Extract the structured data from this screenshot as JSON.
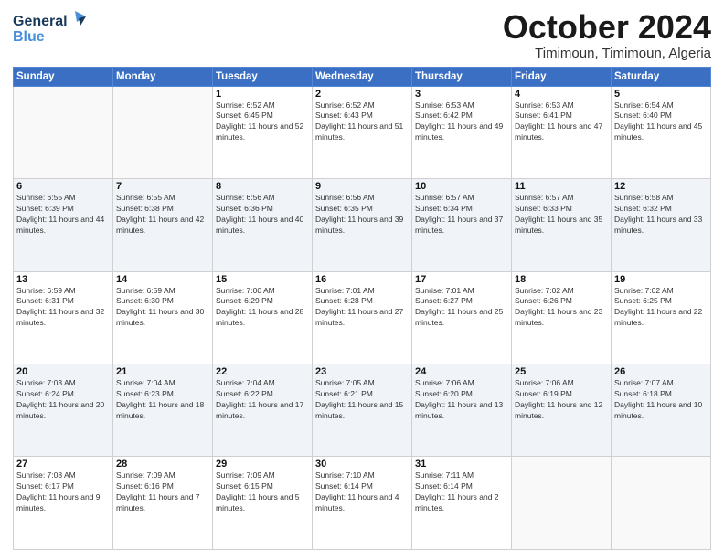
{
  "header": {
    "logo_general": "General",
    "logo_blue": "Blue",
    "month_title": "October 2024",
    "location": "Timimoun, Timimoun, Algeria"
  },
  "weekdays": [
    "Sunday",
    "Monday",
    "Tuesday",
    "Wednesday",
    "Thursday",
    "Friday",
    "Saturday"
  ],
  "weeks": [
    [
      {
        "day": "",
        "sunrise": "",
        "sunset": "",
        "daylight": ""
      },
      {
        "day": "",
        "sunrise": "",
        "sunset": "",
        "daylight": ""
      },
      {
        "day": "1",
        "sunrise": "Sunrise: 6:52 AM",
        "sunset": "Sunset: 6:45 PM",
        "daylight": "Daylight: 11 hours and 52 minutes."
      },
      {
        "day": "2",
        "sunrise": "Sunrise: 6:52 AM",
        "sunset": "Sunset: 6:43 PM",
        "daylight": "Daylight: 11 hours and 51 minutes."
      },
      {
        "day": "3",
        "sunrise": "Sunrise: 6:53 AM",
        "sunset": "Sunset: 6:42 PM",
        "daylight": "Daylight: 11 hours and 49 minutes."
      },
      {
        "day": "4",
        "sunrise": "Sunrise: 6:53 AM",
        "sunset": "Sunset: 6:41 PM",
        "daylight": "Daylight: 11 hours and 47 minutes."
      },
      {
        "day": "5",
        "sunrise": "Sunrise: 6:54 AM",
        "sunset": "Sunset: 6:40 PM",
        "daylight": "Daylight: 11 hours and 45 minutes."
      }
    ],
    [
      {
        "day": "6",
        "sunrise": "Sunrise: 6:55 AM",
        "sunset": "Sunset: 6:39 PM",
        "daylight": "Daylight: 11 hours and 44 minutes."
      },
      {
        "day": "7",
        "sunrise": "Sunrise: 6:55 AM",
        "sunset": "Sunset: 6:38 PM",
        "daylight": "Daylight: 11 hours and 42 minutes."
      },
      {
        "day": "8",
        "sunrise": "Sunrise: 6:56 AM",
        "sunset": "Sunset: 6:36 PM",
        "daylight": "Daylight: 11 hours and 40 minutes."
      },
      {
        "day": "9",
        "sunrise": "Sunrise: 6:56 AM",
        "sunset": "Sunset: 6:35 PM",
        "daylight": "Daylight: 11 hours and 39 minutes."
      },
      {
        "day": "10",
        "sunrise": "Sunrise: 6:57 AM",
        "sunset": "Sunset: 6:34 PM",
        "daylight": "Daylight: 11 hours and 37 minutes."
      },
      {
        "day": "11",
        "sunrise": "Sunrise: 6:57 AM",
        "sunset": "Sunset: 6:33 PM",
        "daylight": "Daylight: 11 hours and 35 minutes."
      },
      {
        "day": "12",
        "sunrise": "Sunrise: 6:58 AM",
        "sunset": "Sunset: 6:32 PM",
        "daylight": "Daylight: 11 hours and 33 minutes."
      }
    ],
    [
      {
        "day": "13",
        "sunrise": "Sunrise: 6:59 AM",
        "sunset": "Sunset: 6:31 PM",
        "daylight": "Daylight: 11 hours and 32 minutes."
      },
      {
        "day": "14",
        "sunrise": "Sunrise: 6:59 AM",
        "sunset": "Sunset: 6:30 PM",
        "daylight": "Daylight: 11 hours and 30 minutes."
      },
      {
        "day": "15",
        "sunrise": "Sunrise: 7:00 AM",
        "sunset": "Sunset: 6:29 PM",
        "daylight": "Daylight: 11 hours and 28 minutes."
      },
      {
        "day": "16",
        "sunrise": "Sunrise: 7:01 AM",
        "sunset": "Sunset: 6:28 PM",
        "daylight": "Daylight: 11 hours and 27 minutes."
      },
      {
        "day": "17",
        "sunrise": "Sunrise: 7:01 AM",
        "sunset": "Sunset: 6:27 PM",
        "daylight": "Daylight: 11 hours and 25 minutes."
      },
      {
        "day": "18",
        "sunrise": "Sunrise: 7:02 AM",
        "sunset": "Sunset: 6:26 PM",
        "daylight": "Daylight: 11 hours and 23 minutes."
      },
      {
        "day": "19",
        "sunrise": "Sunrise: 7:02 AM",
        "sunset": "Sunset: 6:25 PM",
        "daylight": "Daylight: 11 hours and 22 minutes."
      }
    ],
    [
      {
        "day": "20",
        "sunrise": "Sunrise: 7:03 AM",
        "sunset": "Sunset: 6:24 PM",
        "daylight": "Daylight: 11 hours and 20 minutes."
      },
      {
        "day": "21",
        "sunrise": "Sunrise: 7:04 AM",
        "sunset": "Sunset: 6:23 PM",
        "daylight": "Daylight: 11 hours and 18 minutes."
      },
      {
        "day": "22",
        "sunrise": "Sunrise: 7:04 AM",
        "sunset": "Sunset: 6:22 PM",
        "daylight": "Daylight: 11 hours and 17 minutes."
      },
      {
        "day": "23",
        "sunrise": "Sunrise: 7:05 AM",
        "sunset": "Sunset: 6:21 PM",
        "daylight": "Daylight: 11 hours and 15 minutes."
      },
      {
        "day": "24",
        "sunrise": "Sunrise: 7:06 AM",
        "sunset": "Sunset: 6:20 PM",
        "daylight": "Daylight: 11 hours and 13 minutes."
      },
      {
        "day": "25",
        "sunrise": "Sunrise: 7:06 AM",
        "sunset": "Sunset: 6:19 PM",
        "daylight": "Daylight: 11 hours and 12 minutes."
      },
      {
        "day": "26",
        "sunrise": "Sunrise: 7:07 AM",
        "sunset": "Sunset: 6:18 PM",
        "daylight": "Daylight: 11 hours and 10 minutes."
      }
    ],
    [
      {
        "day": "27",
        "sunrise": "Sunrise: 7:08 AM",
        "sunset": "Sunset: 6:17 PM",
        "daylight": "Daylight: 11 hours and 9 minutes."
      },
      {
        "day": "28",
        "sunrise": "Sunrise: 7:09 AM",
        "sunset": "Sunset: 6:16 PM",
        "daylight": "Daylight: 11 hours and 7 minutes."
      },
      {
        "day": "29",
        "sunrise": "Sunrise: 7:09 AM",
        "sunset": "Sunset: 6:15 PM",
        "daylight": "Daylight: 11 hours and 5 minutes."
      },
      {
        "day": "30",
        "sunrise": "Sunrise: 7:10 AM",
        "sunset": "Sunset: 6:14 PM",
        "daylight": "Daylight: 11 hours and 4 minutes."
      },
      {
        "day": "31",
        "sunrise": "Sunrise: 7:11 AM",
        "sunset": "Sunset: 6:14 PM",
        "daylight": "Daylight: 11 hours and 2 minutes."
      },
      {
        "day": "",
        "sunrise": "",
        "sunset": "",
        "daylight": ""
      },
      {
        "day": "",
        "sunrise": "",
        "sunset": "",
        "daylight": ""
      }
    ]
  ]
}
